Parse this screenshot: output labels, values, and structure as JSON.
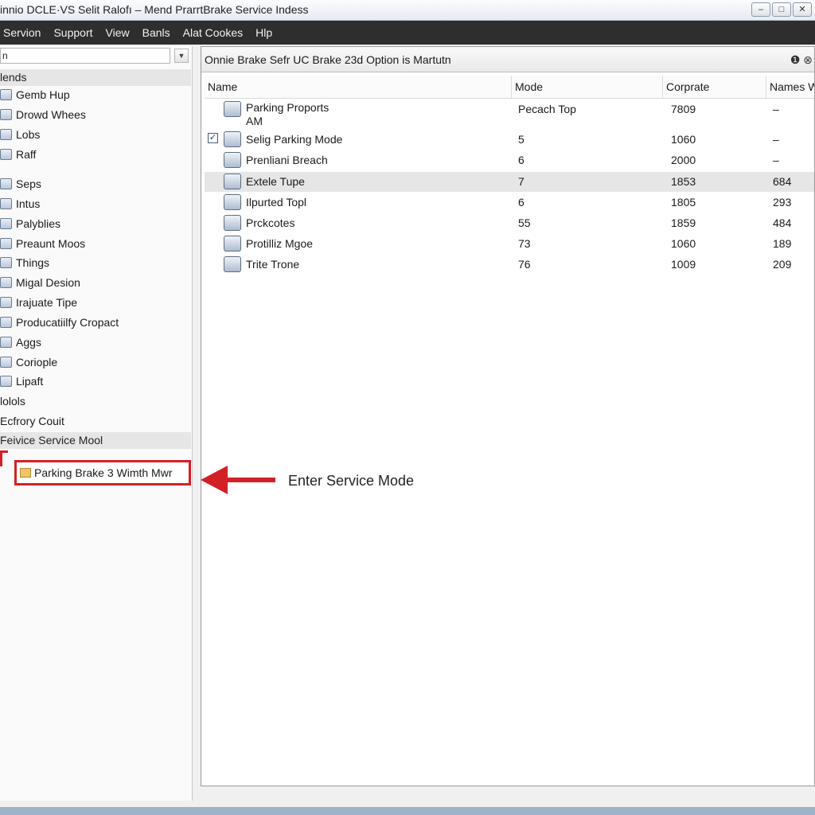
{
  "window": {
    "title": "innio DCLE·VS Selit Ralofı – Mend PrarrtBrake Service Indess",
    "buttons": [
      "–",
      "□",
      "✕"
    ]
  },
  "menu": [
    "Servion",
    "Support",
    "View",
    "Banls",
    "Alat Cookes",
    "Hlp"
  ],
  "left_panel": {
    "search_value": "n",
    "section_header": "lends",
    "items": [
      {
        "label": "Gemb Hup",
        "icon": "tool-icon"
      },
      {
        "label": "Drowd Whees",
        "icon": "wheel-icon"
      },
      {
        "label": "Lobs",
        "icon": "folder-icon"
      },
      {
        "label": "Raff",
        "icon": "person-icon"
      },
      {
        "label": "Seps",
        "icon": "gear-icon"
      },
      {
        "label": "Intus",
        "icon": "folder-icon"
      },
      {
        "label": "Palyblies",
        "icon": "list-icon"
      },
      {
        "label": "Preaunt Moos",
        "icon": "monitor-icon"
      },
      {
        "label": "Things",
        "icon": "box-icon"
      },
      {
        "label": "Migal Desion",
        "icon": "chart-icon"
      },
      {
        "label": "Irajuate Tipe",
        "icon": "document-icon"
      },
      {
        "label": "Producatiilfy Cropact",
        "icon": "clipboard-icon"
      },
      {
        "label": "Aggs",
        "icon": "stack-icon"
      },
      {
        "label": "Coriople",
        "icon": "terminal-icon"
      },
      {
        "label": "Lipaft",
        "icon": "users-icon"
      },
      {
        "label": "lolols",
        "icon": ""
      },
      {
        "label": "Ecfrory Couit",
        "icon": ""
      }
    ],
    "subsection_header": "Feivice Service Mool",
    "selected_node": "Parking Brake 3 Wimth Mwr"
  },
  "right_panel": {
    "header": "Onnie Brake Sefr UC Brake 23d Option is Martutn",
    "header_icons": [
      "help-icon",
      "close-icon"
    ],
    "columns": [
      "Name",
      "Mode",
      "Corprate",
      "Names W"
    ],
    "rows": [
      {
        "name": "Parking Proports AM",
        "mode": "Pecach Top",
        "corprate": "7809",
        "names": "–",
        "checked": false,
        "highlight": false
      },
      {
        "name": "Selig Parking Mode",
        "mode": "5",
        "corprate": "1060",
        "names": "–",
        "checked": true,
        "highlight": false
      },
      {
        "name": "Prenliani Breach",
        "mode": "6",
        "corprate": "2000",
        "names": "–",
        "checked": false,
        "highlight": false
      },
      {
        "name": "Extele Tupe",
        "mode": "7",
        "corprate": "1853",
        "names": "684",
        "checked": false,
        "highlight": true
      },
      {
        "name": "Ilpurted Topl",
        "mode": "6",
        "corprate": "1805",
        "names": "293",
        "checked": false,
        "highlight": false
      },
      {
        "name": "Prckcotes",
        "mode": "55",
        "corprate": "1859",
        "names": "484",
        "checked": false,
        "highlight": false
      },
      {
        "name": "Protilliz Mgoe",
        "mode": "73",
        "corprate": "1060",
        "names": "189",
        "checked": false,
        "highlight": false
      },
      {
        "name": "Trite Trone",
        "mode": "76",
        "corprate": "1009",
        "names": "209",
        "checked": false,
        "highlight": false
      }
    ]
  },
  "annotation": {
    "label": "Enter Service Mode",
    "color": "#d32027"
  }
}
